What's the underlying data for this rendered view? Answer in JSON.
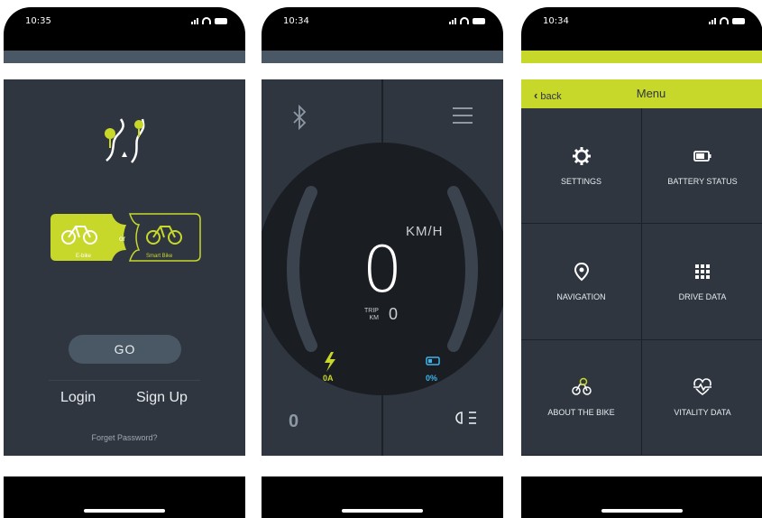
{
  "screen1": {
    "time": "10:35",
    "ebike_label": "E-bike",
    "or_label": "or",
    "smart_bike_label": "Smart Bike",
    "go_label": "GO",
    "login_label": "Login",
    "signup_label": "Sign Up",
    "forgot_label": "Forget Password?"
  },
  "screen2": {
    "time": "10:34",
    "speed": "0",
    "unit": "KM/H",
    "trip_label_1": "TRIP",
    "trip_label_2": "KM",
    "trip_value": "0",
    "current": "0A",
    "battery_percent": "0%",
    "odometer": "0"
  },
  "screen3": {
    "time": "10:34",
    "back_label": "back",
    "title": "Menu",
    "items": [
      {
        "label": "SETTINGS",
        "icon": "gear-icon"
      },
      {
        "label": "BATTERY STATUS",
        "icon": "battery-icon"
      },
      {
        "label": "NAVIGATION",
        "icon": "location-pin-icon"
      },
      {
        "label": "DRIVE DATA",
        "icon": "grid-icon"
      },
      {
        "label": "ABOUT THE BIKE",
        "icon": "bike-icon"
      },
      {
        "label": "VITALITY DATA",
        "icon": "heartbeat-icon"
      }
    ]
  },
  "colors": {
    "accent": "#c7d82b",
    "background": "#2f3640",
    "battery_blue": "#3db4ec"
  }
}
